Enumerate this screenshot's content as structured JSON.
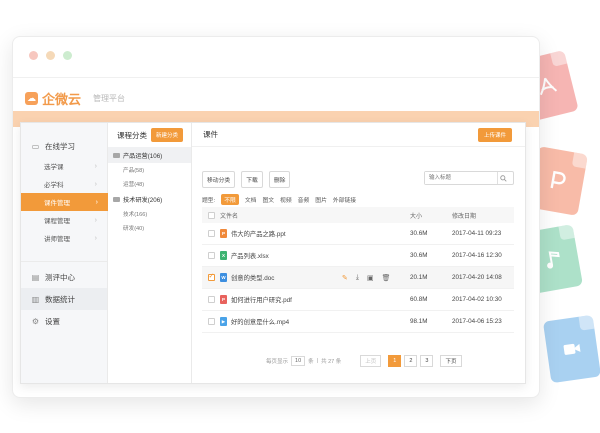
{
  "window": {
    "brand_name": "企微云",
    "brand_subtitle": "管理平台"
  },
  "nav": {
    "groups": [
      {
        "label": "在线学习",
        "icon": "monitor-icon"
      },
      {
        "label": "测评中心",
        "icon": "document-icon"
      },
      {
        "label": "数据统计",
        "icon": "chart-icon"
      },
      {
        "label": "设置",
        "icon": "gear-icon"
      }
    ],
    "items": [
      {
        "label": "选学课",
        "active": false
      },
      {
        "label": "必学科",
        "active": false
      },
      {
        "label": "课件管理",
        "active": true
      },
      {
        "label": "课程管理",
        "active": false
      },
      {
        "label": "讲师管理",
        "active": false
      }
    ]
  },
  "categories": {
    "title": "课程分类",
    "new_button": "新建分类",
    "groups": [
      {
        "label": "产品运营(106)",
        "selected": true,
        "children": [
          "产品(58)",
          "运营(48)"
        ]
      },
      {
        "label": "技术研发(206)",
        "selected": false,
        "children": [
          "技术(166)",
          "研发(40)"
        ]
      }
    ]
  },
  "content": {
    "title": "课件",
    "upload_button": "上传课件",
    "toolbar": {
      "move_label": "移动分类",
      "download_label": "下载",
      "delete_label": "删除"
    },
    "search_placeholder": "输入标题",
    "filter_label": "题型:",
    "filters": [
      "不限",
      "文档",
      "图文",
      "视频",
      "音频",
      "图片",
      "外部链接"
    ],
    "selected_filter": "不限",
    "columns": {
      "name": "文件名",
      "size": "大小",
      "date": "修改日期"
    },
    "files": [
      {
        "name": "伟大的产品之路.ppt",
        "size": "30.6M",
        "date": "2017-04-11 09:23",
        "icon": "ppt-file-icon",
        "color": "#f0893a",
        "glyph": "P",
        "checked": false
      },
      {
        "name": "产品列表.xlsx",
        "size": "30.6M",
        "date": "2017-04-16 12:30",
        "icon": "excel-file-icon",
        "color": "#3cb371",
        "glyph": "X",
        "checked": false
      },
      {
        "name": "创意的类型.doc",
        "size": "20.1M",
        "date": "2017-04-20 14:08",
        "icon": "word-file-icon",
        "color": "#3d8fe0",
        "glyph": "W",
        "checked": true
      },
      {
        "name": "如何进行用户研究.pdf",
        "size": "60.8M",
        "date": "2017-04-02 10:30",
        "icon": "pdf-file-icon",
        "color": "#e8625d",
        "glyph": "P",
        "checked": false
      },
      {
        "name": "好的创意是什么.mp4",
        "size": "98.1M",
        "date": "2017-04-06 15:23",
        "icon": "video-file-icon",
        "color": "#4aa3e8",
        "glyph": "▶",
        "checked": false
      }
    ]
  },
  "pager": {
    "per_page_label": "每页显示",
    "per_page_value": "10",
    "per_page_unit": "条",
    "total_label": "共 27 条",
    "prev_label": "上页",
    "pages": [
      "1",
      "2",
      "3"
    ],
    "current_page": "1",
    "next_label": "下页"
  },
  "colors": {
    "accent": "#f29a3a",
    "band": "#fad2b0"
  }
}
